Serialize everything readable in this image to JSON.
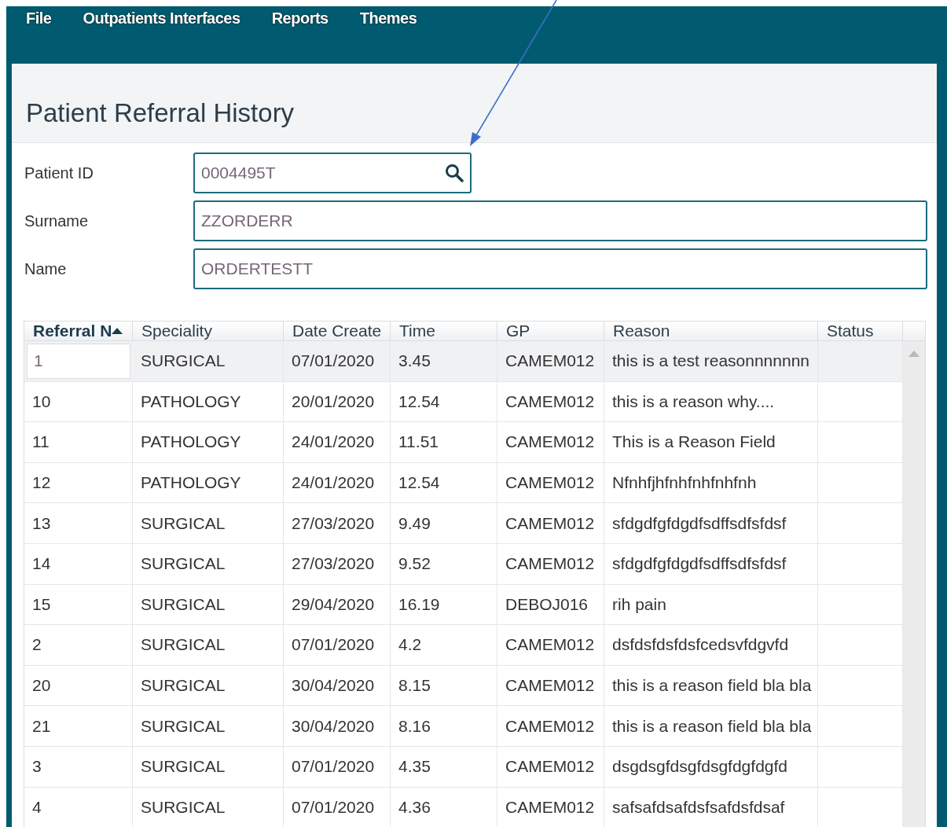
{
  "menu": [
    "File",
    "Outpatients Interfaces",
    "Reports",
    "Themes"
  ],
  "page": {
    "title": "Patient Referral History"
  },
  "form": [
    {
      "label": "Patient ID",
      "value": "0004495T",
      "kind": "search"
    },
    {
      "label": "Surname",
      "value": "ZZORDERR",
      "kind": "text"
    },
    {
      "label": "Name",
      "value": "ORDERTESTT",
      "kind": "text"
    }
  ],
  "table": {
    "columns": [
      {
        "label": "Referral N",
        "sorted": true
      },
      {
        "label": "Speciality",
        "sorted": false
      },
      {
        "label": "Date Create",
        "sorted": false
      },
      {
        "label": "Time",
        "sorted": false
      },
      {
        "label": "GP",
        "sorted": false
      },
      {
        "label": "Reason",
        "sorted": false
      },
      {
        "label": "Status",
        "sorted": false
      }
    ],
    "rows": [
      {
        "cells": [
          "1",
          "SURGICAL",
          "07/01/2020",
          "3.45",
          "CAMEM012",
          "this is a test reasonnnnnnn",
          ""
        ],
        "selected": true
      },
      {
        "cells": [
          "10",
          "PATHOLOGY",
          "20/01/2020",
          "12.54",
          "CAMEM012",
          "this is a reason why....",
          ""
        ],
        "selected": false
      },
      {
        "cells": [
          "11",
          "PATHOLOGY",
          "24/01/2020",
          "11.51",
          "CAMEM012",
          "This is a Reason Field",
          ""
        ],
        "selected": false
      },
      {
        "cells": [
          "12",
          "PATHOLOGY",
          "24/01/2020",
          "12.54",
          "CAMEM012",
          "Nfnhfjhfnhfnhfnhfnh",
          ""
        ],
        "selected": false
      },
      {
        "cells": [
          "13",
          "SURGICAL",
          "27/03/2020",
          "9.49",
          "CAMEM012",
          "sfdgdfgfdgdfsdffsdfsfdsf",
          ""
        ],
        "selected": false
      },
      {
        "cells": [
          "14",
          "SURGICAL",
          "27/03/2020",
          "9.52",
          "CAMEM012",
          "sfdgdfgfdgdfsdffsdfsfdsf",
          ""
        ],
        "selected": false
      },
      {
        "cells": [
          "15",
          "SURGICAL",
          "29/04/2020",
          "16.19",
          "DEBOJ016",
          "rih pain",
          ""
        ],
        "selected": false
      },
      {
        "cells": [
          "2",
          "SURGICAL",
          "07/01/2020",
          "4.2",
          "CAMEM012",
          "dsfdsfdsfdsfcedsvfdgvfd",
          ""
        ],
        "selected": false
      },
      {
        "cells": [
          "20",
          "SURGICAL",
          "30/04/2020",
          "8.15",
          "CAMEM012",
          "this is a reason field bla bla",
          ""
        ],
        "selected": false
      },
      {
        "cells": [
          "21",
          "SURGICAL",
          "30/04/2020",
          "8.16",
          "CAMEM012",
          "this is a reason field bla bla",
          ""
        ],
        "selected": false
      },
      {
        "cells": [
          "3",
          "SURGICAL",
          "07/01/2020",
          "4.35",
          "CAMEM012",
          "dsgdsgfdsgfdsgfdgfdgfd",
          ""
        ],
        "selected": false
      },
      {
        "cells": [
          "4",
          "SURGICAL",
          "07/01/2020",
          "4.36",
          "CAMEM012",
          "safsafdsafdsfsafdsfdsaf",
          ""
        ],
        "selected": false
      }
    ]
  }
}
